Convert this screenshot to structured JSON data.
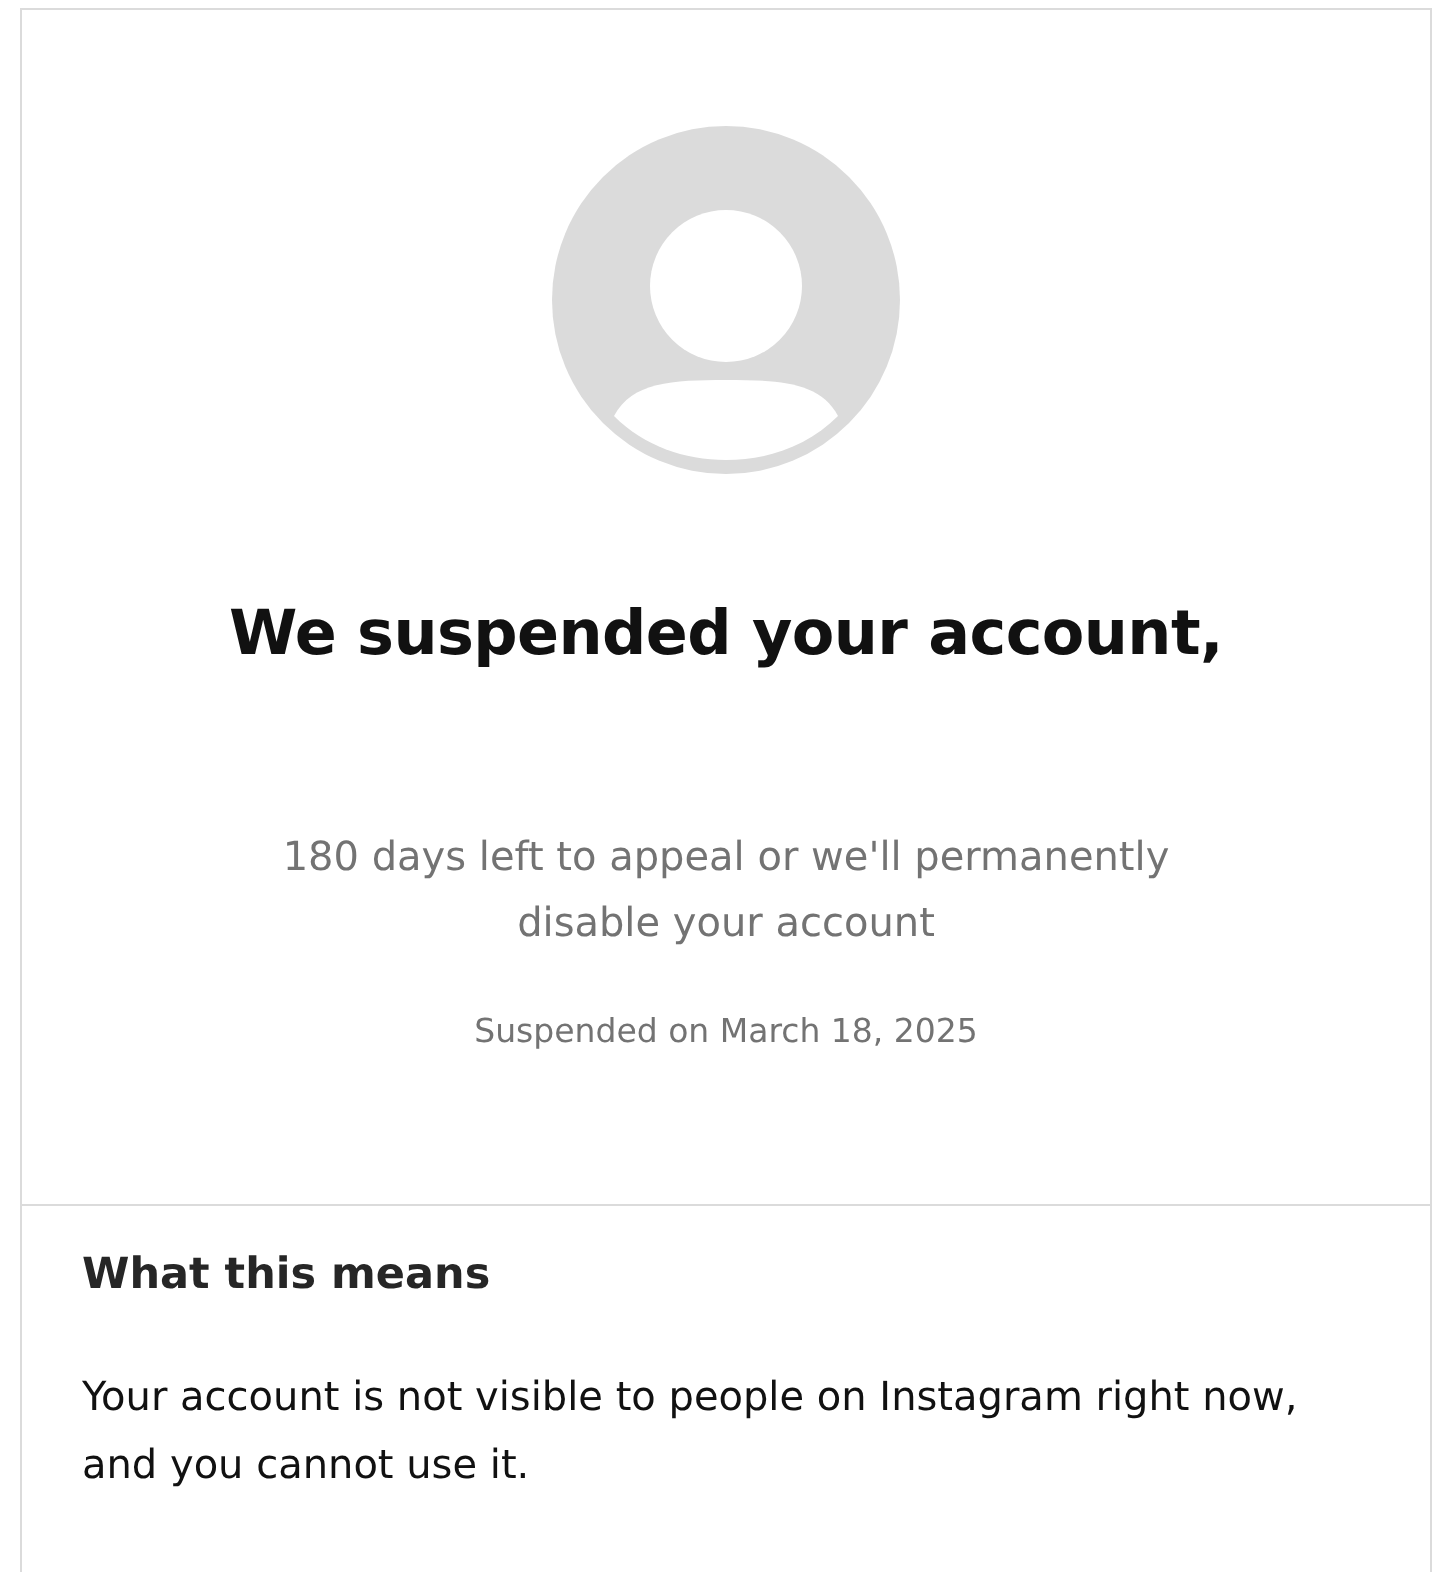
{
  "avatar": {
    "kind": "placeholder"
  },
  "title": "We suspended your account,",
  "subtitle": "180 days left to appeal or we'll permanently disable your account",
  "suspended_date": "Suspended on March 18, 2025",
  "section": {
    "heading": "What this means",
    "body": "Your account is not visible to people on Instagram right now, and you cannot use it."
  }
}
